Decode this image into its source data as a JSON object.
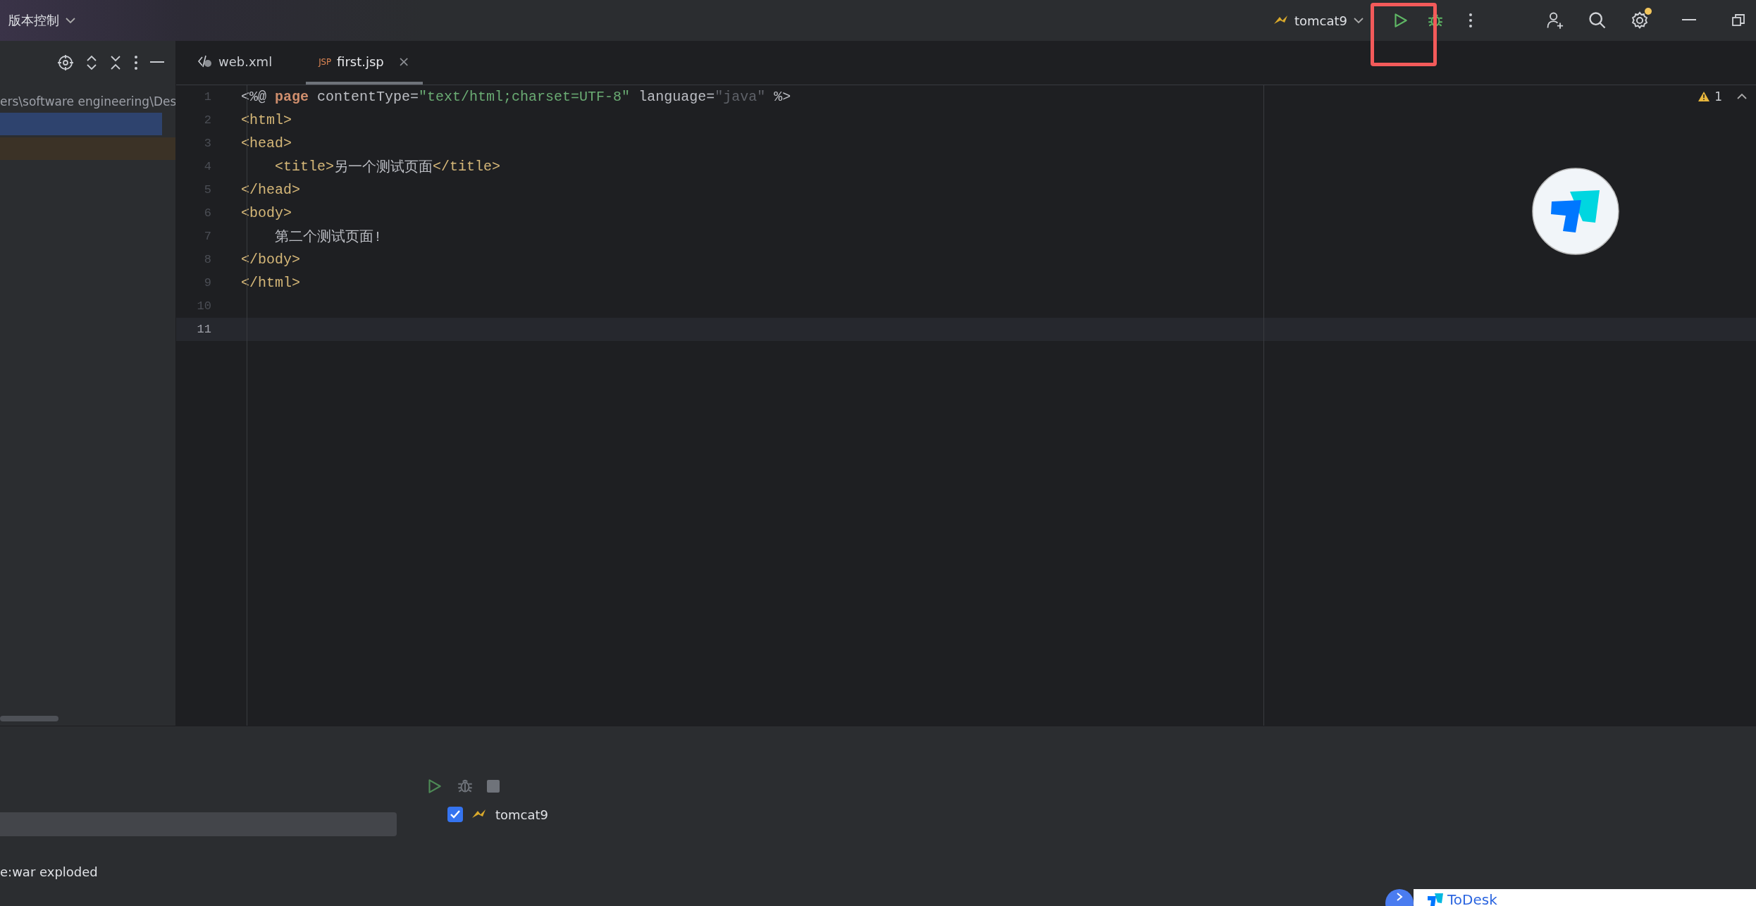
{
  "toolbar": {
    "vcs_menu": "版本控制",
    "run_config": "tomcat9",
    "settings_badge": true
  },
  "project_panel": {
    "path": "ers\\software engineering\\Des",
    "rows": [
      {
        "kind": "selected"
      },
      {
        "kind": "modified"
      }
    ]
  },
  "tabs": [
    {
      "label": "web.xml",
      "kind": "xml",
      "selected": false
    },
    {
      "label": "first.jsp",
      "kind": "jsp",
      "badge": "JSP",
      "selected": true,
      "close": "×"
    }
  ],
  "editor": {
    "warnings": "1",
    "lines": [
      {
        "number": "1",
        "current": false,
        "tokens": [
          {
            "text": "<%@ ",
            "kind": "plain"
          },
          {
            "text": "page",
            "kind": "keyword"
          },
          {
            "text": " contentType=",
            "kind": "plain"
          },
          {
            "text": "\"text/html;charset=UTF-8\"",
            "kind": "string"
          },
          {
            "text": " language=",
            "kind": "plain"
          },
          {
            "text": "\"java\"",
            "kind": "dim"
          },
          {
            "text": " %>",
            "kind": "plain"
          }
        ]
      },
      {
        "number": "2",
        "current": false,
        "tokens": [
          {
            "text": "<html>",
            "kind": "tag"
          }
        ]
      },
      {
        "number": "3",
        "current": false,
        "tokens": [
          {
            "text": "<head>",
            "kind": "tag"
          }
        ]
      },
      {
        "number": "4",
        "current": false,
        "tokens": [
          {
            "text": "    <title>",
            "kind": "tag"
          },
          {
            "text": "另一个测试页面",
            "kind": "plain"
          },
          {
            "text": "</title>",
            "kind": "tag"
          }
        ]
      },
      {
        "number": "5",
        "current": false,
        "tokens": [
          {
            "text": "</head>",
            "kind": "tag"
          }
        ]
      },
      {
        "number": "6",
        "current": false,
        "tokens": [
          {
            "text": "<body>",
            "kind": "tag"
          }
        ]
      },
      {
        "number": "7",
        "current": false,
        "tokens": [
          {
            "text": "    第二个测试页面!",
            "kind": "plain"
          }
        ]
      },
      {
        "number": "8",
        "current": false,
        "tokens": [
          {
            "text": "</body>",
            "kind": "tag"
          }
        ]
      },
      {
        "number": "9",
        "current": false,
        "tokens": [
          {
            "text": "</html>",
            "kind": "tag"
          }
        ]
      },
      {
        "number": "10",
        "current": false
      },
      {
        "number": "11",
        "current": true
      }
    ]
  },
  "services": {
    "artifact": "e:war exploded",
    "servers": [
      {
        "name": "tomcat9",
        "checked": true
      }
    ]
  },
  "todesk": {
    "label": "ToDesk"
  }
}
